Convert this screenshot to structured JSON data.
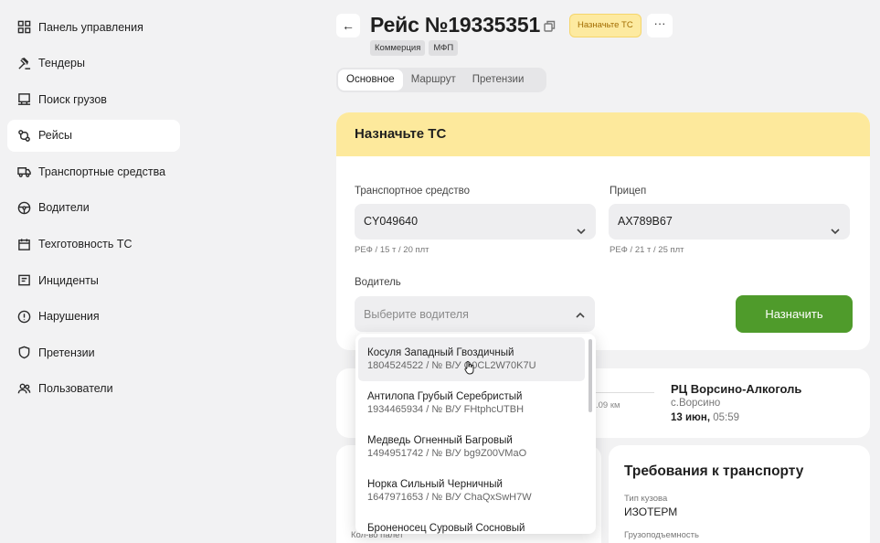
{
  "sidebar": {
    "items": [
      {
        "label": "Панель управления",
        "icon": "dashboard-icon"
      },
      {
        "label": "Тендеры",
        "icon": "gavel-icon"
      },
      {
        "label": "Поиск грузов",
        "icon": "cargo-search-icon"
      },
      {
        "label": "Рейсы",
        "icon": "route-icon",
        "active": true
      },
      {
        "label": "Транспортные средства",
        "icon": "truck-icon"
      },
      {
        "label": "Водители",
        "icon": "steering-wheel-icon"
      },
      {
        "label": "Техготовность ТС",
        "icon": "calendar-icon"
      },
      {
        "label": "Инциденты",
        "icon": "incident-icon"
      },
      {
        "label": "Нарушения",
        "icon": "alert-icon"
      },
      {
        "label": "Претензии",
        "icon": "shield-icon"
      },
      {
        "label": "Пользователи",
        "icon": "users-icon"
      }
    ]
  },
  "header": {
    "title": "Рейс №19335351",
    "status": "Назначьте ТС",
    "more": "···",
    "back": "←",
    "tags": [
      "Коммерция",
      "МФП"
    ]
  },
  "tabs": [
    {
      "label": "Основное",
      "active": true
    },
    {
      "label": "Маршрут"
    },
    {
      "label": "Претензии"
    }
  ],
  "assign": {
    "title": "Назначьте ТС",
    "vehicle_label": "Транспортное средство",
    "vehicle_value": "CY049640",
    "vehicle_hint": "РЕФ / 15 т / 20 плт",
    "trailer_label": "Прицеп",
    "trailer_value": "AX789B67",
    "trailer_hint": "РЕФ / 21 т / 25 плт",
    "driver_label": "Водитель",
    "driver_placeholder": "Выберите водителя",
    "assign_button": "Назначить"
  },
  "route": {
    "distance": ".09 км",
    "destination": "РЦ Ворсино-Алкоголь",
    "city": "с.Ворсино",
    "date": "13 июн,",
    "time": "05:59"
  },
  "left_card": {
    "label": "Кол-во палет"
  },
  "requirements": {
    "title": "Требования к транспорту",
    "body_type_label": "Тип кузова",
    "body_type_value": "ИЗОТЕРМ",
    "capacity_label": "Грузоподъемность"
  },
  "driver_options": [
    {
      "name": "Косуля Западный Гвоздичный",
      "details": "1804524522 / № В/У O0CL2W70K7U"
    },
    {
      "name": "Антилопа Грубый Серебристый",
      "details": "1934465934 / № В/У FHtphcUTBH"
    },
    {
      "name": "Медведь Огненный Багровый",
      "details": "1494951742 / № В/У bg9Z00VMaO"
    },
    {
      "name": "Норка Сильный Черничный",
      "details": "1647971653 / № В/У ChaQxSwH7W"
    },
    {
      "name": "Броненосец Суровый Сосновый",
      "details": ""
    }
  ],
  "colors": {
    "accent_yellow": "#fde99c",
    "status_text": "#a26c00",
    "assign_green": "#4f9b2b",
    "page_bg": "#f2f2f3"
  }
}
